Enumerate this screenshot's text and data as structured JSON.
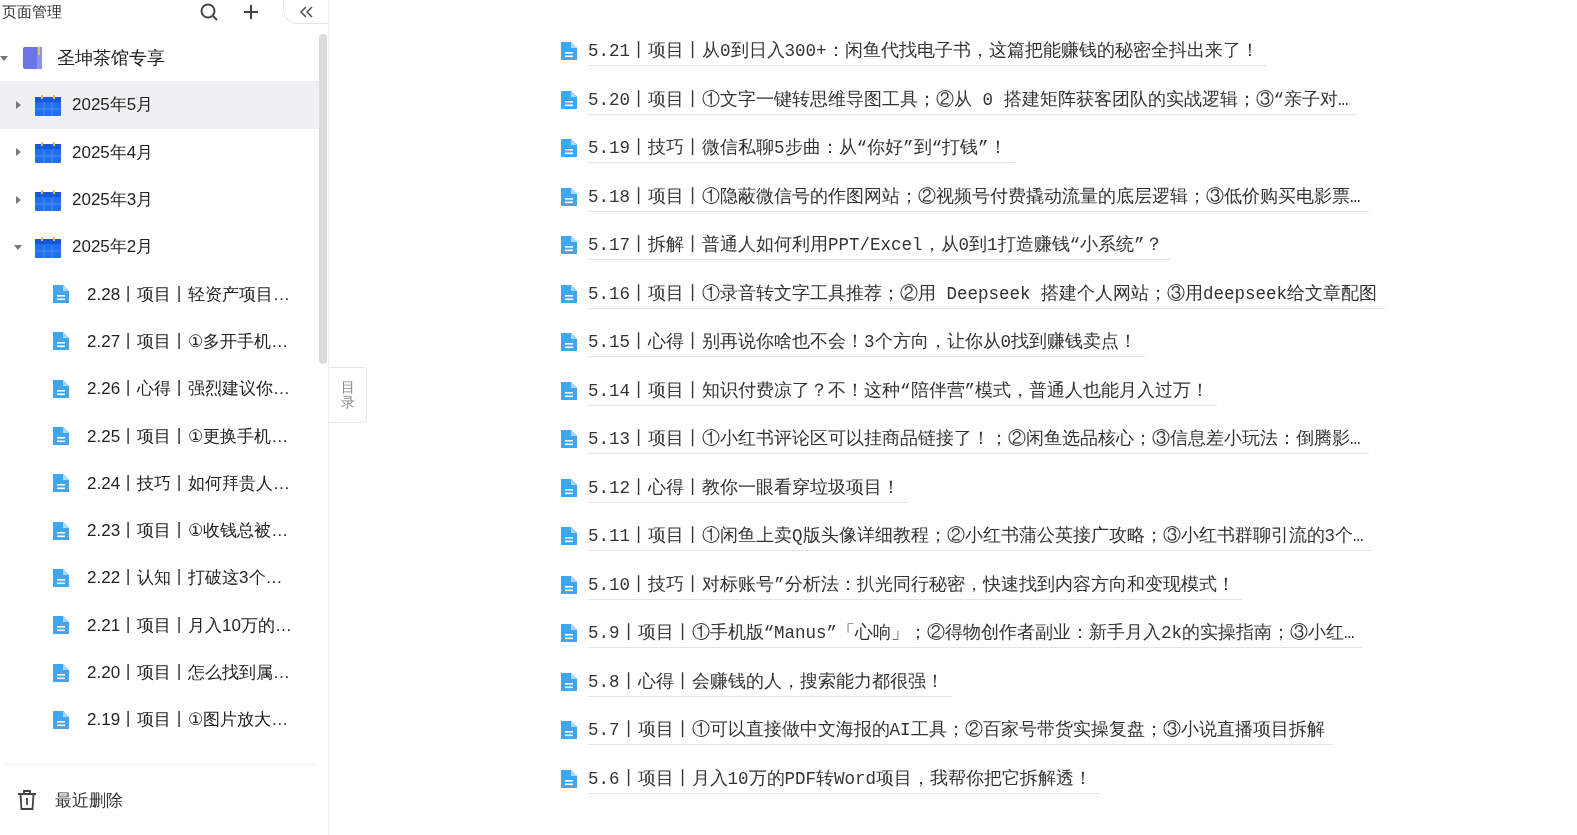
{
  "sidebar": {
    "title": "页面管理",
    "tree": [
      {
        "label": "圣坤茶馆专享",
        "kind": "book",
        "expanded": true,
        "selected": false,
        "children": [
          {
            "label": "2025年5月",
            "kind": "month",
            "expanded": false,
            "selected": true
          },
          {
            "label": "2025年4月",
            "kind": "month",
            "expanded": false,
            "selected": false
          },
          {
            "label": "2025年3月",
            "kind": "month",
            "expanded": false,
            "selected": false
          },
          {
            "label": "2025年2月",
            "kind": "month",
            "expanded": true,
            "selected": false,
            "children": [
              {
                "label": "2.28丨项目丨轻资产项目…",
                "kind": "doc",
                "selected": false
              },
              {
                "label": "2.27丨项目丨①多开手机…",
                "kind": "doc",
                "selected": false
              },
              {
                "label": "2.26丨心得丨强烈建议你…",
                "kind": "doc",
                "selected": false
              },
              {
                "label": "2.25丨项目丨①更换手机…",
                "kind": "doc",
                "selected": false
              },
              {
                "label": "2.24丨技巧丨如何拜贵人…",
                "kind": "doc",
                "selected": false
              },
              {
                "label": "2.23丨项目丨①收钱总被…",
                "kind": "doc",
                "selected": false
              },
              {
                "label": "2.22丨认知丨打破这3个…",
                "kind": "doc",
                "selected": false
              },
              {
                "label": "2.21丨项目丨月入10万的…",
                "kind": "doc",
                "selected": false
              },
              {
                "label": "2.20丨项目丨怎么找到属…",
                "kind": "doc",
                "selected": false
              },
              {
                "label": "2.19丨项目丨①图片放大…",
                "kind": "doc",
                "selected": false
              }
            ]
          }
        ]
      }
    ],
    "footer": "最近删除"
  },
  "toc_tab": "目录",
  "documents": [
    {
      "title": "5.21丨项目丨从0到日入300+：闲鱼代找电子书，这篇把能赚钱的秘密全抖出来了！"
    },
    {
      "title": "5.20丨项目丨①文字一键转思维导图工具；②从 0 搭建矩阵获客团队的实战逻辑；③“亲子对…"
    },
    {
      "title": "5.19丨技巧丨微信私聊5步曲：从“你好”到“打钱”！"
    },
    {
      "title": "5.18丨项目丨①隐蔽微信号的作图网站；②视频号付费撬动流量的底层逻辑；③低价购买电影票…"
    },
    {
      "title": "5.17丨拆解丨普通人如何利用PPT/Excel，从0到1打造赚钱“小系统”？"
    },
    {
      "title": "5.16丨项目丨①录音转文字工具推荐；②用 Deepseek 搭建个人网站；③用deepseek给文章配图"
    },
    {
      "title": "5.15丨心得丨别再说你啥也不会！3个方向，让你从0找到赚钱卖点！"
    },
    {
      "title": "5.14丨项目丨知识付费凉了？不！这种“陪伴营”模式，普通人也能月入过万！"
    },
    {
      "title": "5.13丨项目丨①小红书评论区可以挂商品链接了！；②闲鱼选品核心；③信息差小玩法：倒腾影…"
    },
    {
      "title": "5.12丨心得丨教你一眼看穿垃圾项目！"
    },
    {
      "title": "5.11丨项目丨①闲鱼上卖Q版头像详细教程；②小红书蒲公英接广攻略；③小红书群聊引流的3个…"
    },
    {
      "title": "5.10丨技巧丨对标账号”分析法：扒光同行秘密，快速找到内容方向和变现模式！"
    },
    {
      "title": "5.9丨项目丨①手机版“Manus”「心响」；②得物创作者副业：新手月入2k的实操指南；③小红…"
    },
    {
      "title": "5.8丨心得丨会赚钱的人，搜索能力都很强！"
    },
    {
      "title": "5.7丨项目丨①可以直接做中文海报的AI工具；②百家号带货实操复盘；③小说直播项目拆解"
    },
    {
      "title": "5.6丨项目丨月入10万的PDF转Word项目，我帮你把它拆解透！"
    }
  ]
}
